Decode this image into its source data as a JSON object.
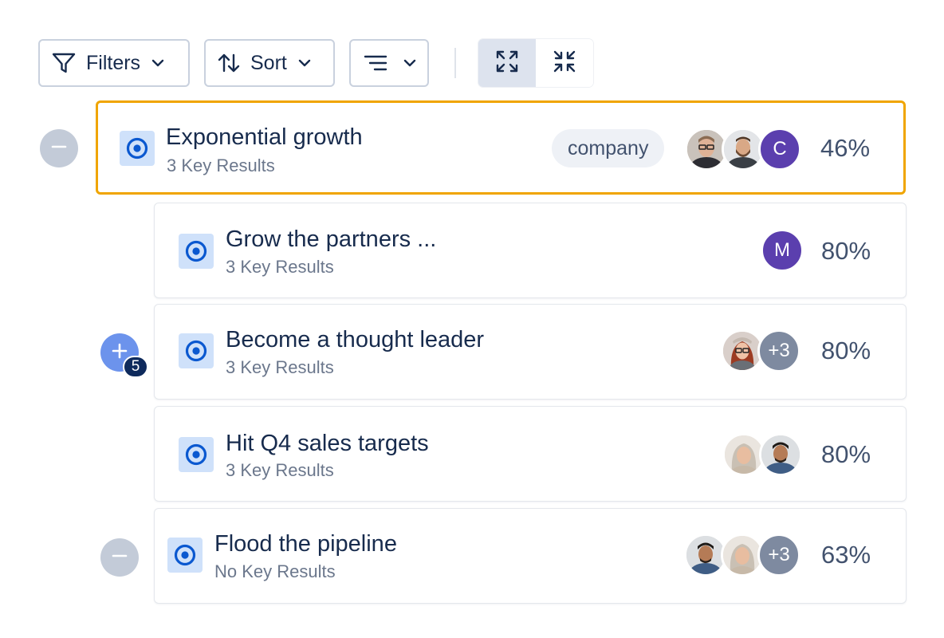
{
  "toolbar": {
    "filters_label": "Filters",
    "sort_label": "Sort",
    "icons": {
      "filter": "filter-icon",
      "sort": "sort-arrows-icon",
      "view": "align-lines-icon",
      "expand": "expand-arrows-icon",
      "collapse": "collapse-arrows-icon"
    },
    "expand_selected": true
  },
  "colors": {
    "selected_border": "#f0a500",
    "icon_blue": "#0a58d0",
    "icon_bg": "#cfe1fa",
    "avatar_purple": "#5b3fae",
    "avatar_gray": "#7e8aa0",
    "badge_navy": "#0e2a5c"
  },
  "objectives": [
    {
      "title": "Exponential growth",
      "subtitle": "3 Key Results",
      "tag": "company",
      "avatars": [
        {
          "type": "photo",
          "name": "man-glasses-photo"
        },
        {
          "type": "photo",
          "name": "man-beard-photo"
        },
        {
          "type": "initial",
          "text": "C"
        }
      ],
      "progress": "46%",
      "selected": true,
      "toggle": "collapse"
    },
    {
      "title": "Grow the partners ...",
      "subtitle": "3 Key Results",
      "avatars": [
        {
          "type": "initial",
          "text": "M"
        }
      ],
      "progress": "80%"
    },
    {
      "title": "Become a thought leader",
      "subtitle": "3 Key Results",
      "avatars": [
        {
          "type": "photo",
          "name": "woman-red-hair-photo"
        },
        {
          "type": "more",
          "text": "+3"
        }
      ],
      "progress": "80%",
      "toggle": "expand",
      "children_count": "5"
    },
    {
      "title": "Hit Q4 sales targets",
      "subtitle": "3 Key Results",
      "avatars": [
        {
          "type": "photo",
          "name": "woman-gray-hair-photo"
        },
        {
          "type": "photo",
          "name": "man-dark-hair-photo"
        }
      ],
      "progress": "80%"
    },
    {
      "title": "Flood the pipeline",
      "subtitle": "No Key Results",
      "avatars": [
        {
          "type": "photo",
          "name": "man-dark-hair-photo"
        },
        {
          "type": "photo",
          "name": "woman-gray-hair-photo"
        },
        {
          "type": "more",
          "text": "+3"
        }
      ],
      "progress": "63%",
      "toggle": "collapse"
    }
  ]
}
